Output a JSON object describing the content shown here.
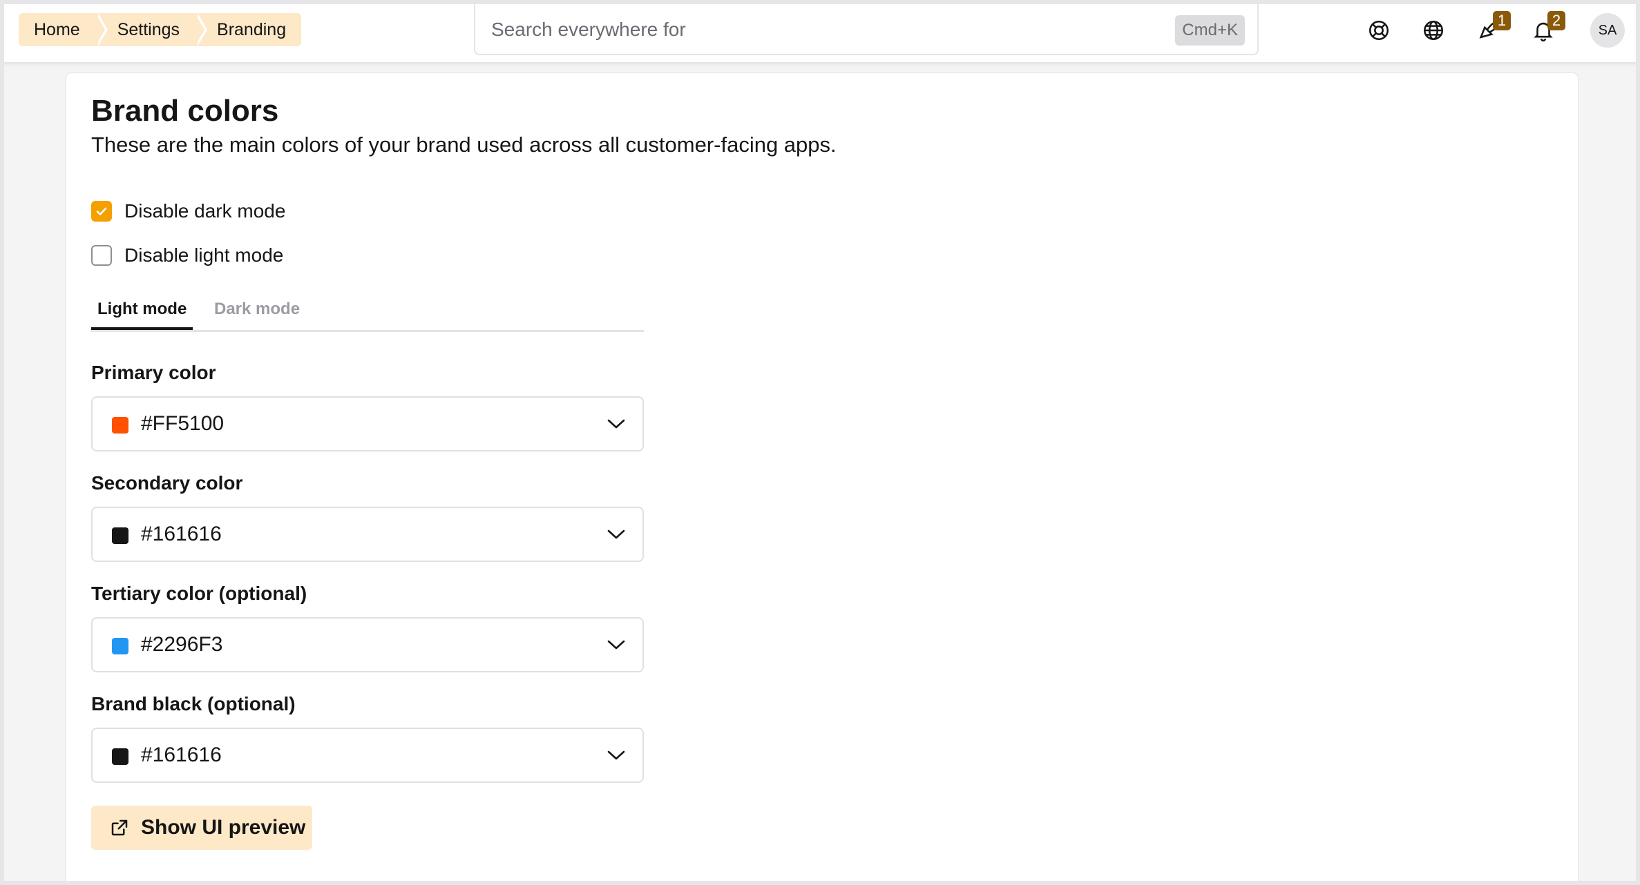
{
  "breadcrumb": [
    "Home",
    "Settings",
    "Branding"
  ],
  "search": {
    "placeholder": "Search everywhere for",
    "shortcut": "Cmd+K"
  },
  "topbar": {
    "icons": [
      "lifebuoy-icon",
      "globe-icon",
      "megaphone-icon",
      "bell-icon"
    ],
    "announcements_count": "1",
    "notifications_count": "2",
    "avatar_initials": "SA"
  },
  "page": {
    "title": "Brand colors",
    "subtitle": "These are the main colors of your brand used across all customer-facing apps."
  },
  "options": {
    "disable_dark": {
      "label": "Disable dark mode",
      "checked": true
    },
    "disable_light": {
      "label": "Disable light mode",
      "checked": false
    }
  },
  "tabs": [
    {
      "label": "Light mode",
      "active": true
    },
    {
      "label": "Dark mode",
      "active": false
    }
  ],
  "fields": [
    {
      "label": "Primary color",
      "value": "#FF5100",
      "swatch": "#FF5100"
    },
    {
      "label": "Secondary color",
      "value": "#161616",
      "swatch": "#161616"
    },
    {
      "label": "Tertiary color (optional)",
      "value": "#2296F3",
      "swatch": "#2296F3"
    },
    {
      "label": "Brand black (optional)",
      "value": "#161616",
      "swatch": "#161616"
    }
  ],
  "preview_button": {
    "label": "Show UI preview"
  },
  "colors": {
    "accent": "#F5A000",
    "crumb_bg": "#FDE8C8",
    "badge": "#8A5A0A"
  }
}
